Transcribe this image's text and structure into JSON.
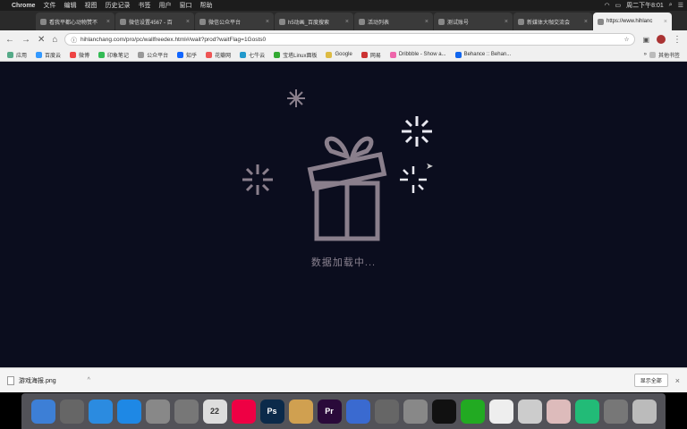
{
  "menubar": {
    "app_name": "Chrome",
    "items": [
      "文件",
      "编辑",
      "视图",
      "历史记录",
      "书签",
      "用户",
      "窗口",
      "帮助"
    ],
    "clock": "周二下午8:01"
  },
  "tabs": [
    {
      "title": "看我平都心动物赞不"
    },
    {
      "title": "微信设置4567 - 百"
    },
    {
      "title": "微信公众平台"
    },
    {
      "title": "h5动画_百度搜索"
    },
    {
      "title": "活动列表"
    },
    {
      "title": "测试账号"
    },
    {
      "title": "新媒体大咖交流会"
    },
    {
      "title": "https://www.hihlanc"
    }
  ],
  "toolbar": {
    "url": "hihlanchang.com/pro/pc/wallfreedex.html#/wait?prod?waitFlag=1Gosts0",
    "back_icon": "arrow-left-icon",
    "forward_icon": "arrow-right-icon",
    "stop_icon": "close-icon",
    "home_icon": "home-icon"
  },
  "bookmarks": {
    "items": [
      "应用",
      "百度云",
      "微博",
      "印象笔记",
      "公众平台",
      "知乎",
      "花瓣网",
      "七牛云",
      "宝塔Linux面板",
      "Google",
      "网易",
      "Dribbble - Show a...",
      "Behance :: Behan..."
    ],
    "other": "其他书签"
  },
  "page": {
    "loading_text": "数据加载中...",
    "accent_color": "#8a7f8c"
  },
  "downloads": {
    "file_name": "游戏海报.png",
    "show_all": "显示全部",
    "close": "×"
  },
  "dock": {
    "items": [
      {
        "name": "finder",
        "color": "#3d7fd6"
      },
      {
        "name": "launchpad",
        "color": "#666"
      },
      {
        "name": "safari",
        "color": "#2b8be0"
      },
      {
        "name": "app-store",
        "color": "#1e88e5"
      },
      {
        "name": "preview",
        "color": "#888"
      },
      {
        "name": "compass",
        "color": "#777"
      },
      {
        "name": "calendar",
        "color": "#ddd",
        "label": "22"
      },
      {
        "name": "quick",
        "color": "#e04"
      },
      {
        "name": "photoshop",
        "color": "#0b2a4a",
        "label": "Ps"
      },
      {
        "name": "browser",
        "color": "#d0a050"
      },
      {
        "name": "premiere",
        "color": "#2a0a3a",
        "label": "Pr"
      },
      {
        "name": "keynote",
        "color": "#3a6ad0"
      },
      {
        "name": "feather",
        "color": "#666"
      },
      {
        "name": "wps",
        "color": "#888"
      },
      {
        "name": "qq",
        "color": "#111"
      },
      {
        "name": "wechat",
        "color": "#2a2"
      },
      {
        "name": "notes",
        "color": "#eee"
      },
      {
        "name": "keyboard",
        "color": "#ccc"
      },
      {
        "name": "network",
        "color": "#dbb"
      },
      {
        "name": "pinwheel",
        "color": "#2b7"
      },
      {
        "name": "disk",
        "color": "#777"
      },
      {
        "name": "trash",
        "color": "#bbb"
      }
    ]
  }
}
